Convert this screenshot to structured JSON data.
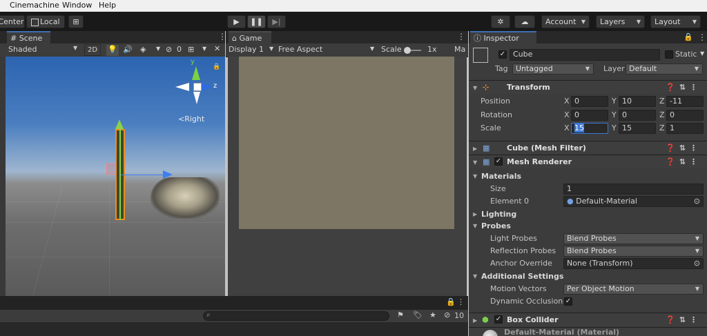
{
  "menubar": {
    "items": [
      "Cinemachine",
      "Window",
      "Help"
    ]
  },
  "toolbar": {
    "pivot": "Center",
    "space": "Local",
    "account": "Account",
    "layers": "Layers",
    "layout": "Layout"
  },
  "scene": {
    "tab_label": "Scene",
    "shading": "Shaded",
    "mode_2d": "2D",
    "hidden_count": "0",
    "gizmo_label": "Right",
    "axes": {
      "y": "y",
      "z": "z"
    }
  },
  "game": {
    "tab_label": "Game",
    "display": "Display 1",
    "aspect": "Free Aspect",
    "scale_label": "Scale",
    "scale_value": "1x",
    "maximize": "Ma"
  },
  "inspector": {
    "tab_label": "Inspector",
    "object_name": "Cube",
    "static_label": "Static",
    "tag_label": "Tag",
    "tag_value": "Untagged",
    "layer_label": "Layer",
    "layer_value": "Default",
    "transform": {
      "title": "Transform",
      "position_label": "Position",
      "rotation_label": "Rotation",
      "scale_label": "Scale",
      "x_label": "X",
      "y_label": "Y",
      "z_label": "Z",
      "position": [
        "0",
        "10",
        "-11"
      ],
      "rotation": [
        "0",
        "0",
        "0"
      ],
      "scale": [
        "15",
        "15",
        "1"
      ]
    },
    "mesh_filter_title": "Cube (Mesh Filter)",
    "mesh_renderer": {
      "title": "Mesh Renderer",
      "materials_label": "Materials",
      "size_label": "Size",
      "size_value": "1",
      "element0_label": "Element 0",
      "element0_value": "Default-Material",
      "lighting_label": "Lighting",
      "probes_label": "Probes",
      "light_probes_label": "Light Probes",
      "light_probes_value": "Blend Probes",
      "reflection_probes_label": "Reflection Probes",
      "reflection_probes_value": "Blend Probes",
      "anchor_override_label": "Anchor Override",
      "anchor_override_value": "None (Transform)",
      "additional_label": "Additional Settings",
      "motion_vectors_label": "Motion Vectors",
      "motion_vectors_value": "Per Object Motion",
      "dynamic_occlusion_label": "Dynamic Occlusion"
    },
    "box_collider_title": "Box Collider",
    "material_preview": "Default-Material (Material)"
  },
  "console": {
    "error_count": "10"
  }
}
